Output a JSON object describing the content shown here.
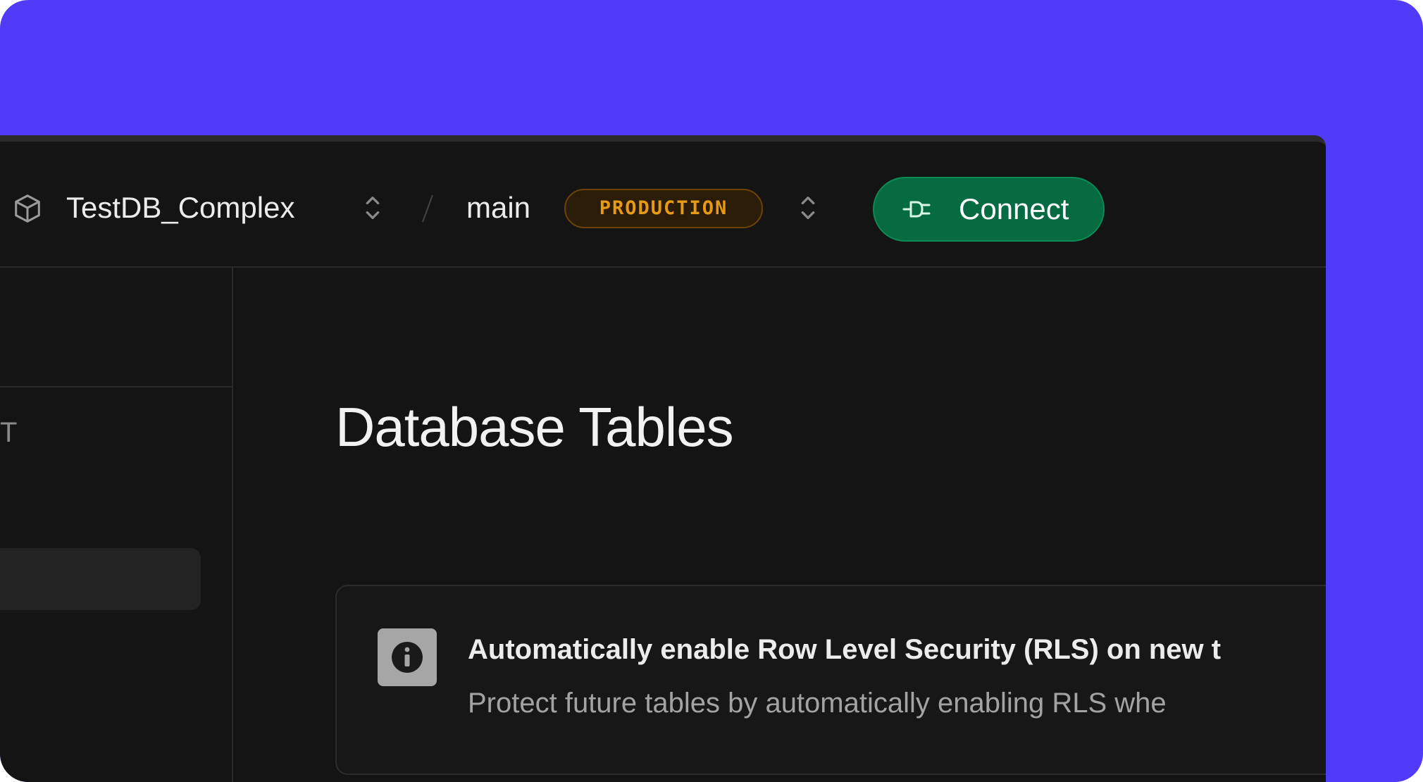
{
  "topbar": {
    "project_name": "TestDB_Complex",
    "separator": "/",
    "branch_name": "main",
    "environment_badge": "PRODUCTION",
    "connect_label": "Connect"
  },
  "sidebar": {
    "clipped_label": "T"
  },
  "main": {
    "page_title": "Database Tables",
    "rls_card": {
      "title": "Automatically enable Row Level Security (RLS) on new t",
      "description": "Protect future tables by automatically enabling RLS whe"
    }
  },
  "colors": {
    "frame_background": "#4f3bf8",
    "app_background": "#141414",
    "connect_button": "#076b41",
    "production_badge_text": "#e79a14"
  },
  "icons": {
    "project": "cube-icon",
    "switcher": "chevron-up-down-icon",
    "connect": "plug-icon",
    "info": "info-icon"
  }
}
